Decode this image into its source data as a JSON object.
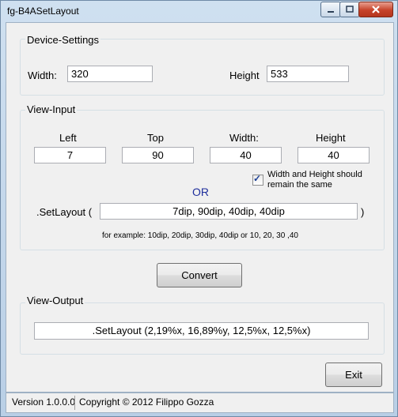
{
  "window": {
    "title": "fg-B4ASetLayout",
    "min_icon": "minimize-icon",
    "max_icon": "maximize-icon",
    "close_icon": "close-icon"
  },
  "device_settings": {
    "group_label": "Device-Settings",
    "width_label": "Width:",
    "width_value": "320",
    "height_label": "Height",
    "height_value": "533"
  },
  "view_input": {
    "group_label": "View-Input",
    "left_label": "Left",
    "left_value": "7",
    "top_label": "Top",
    "top_value": "90",
    "width_label": "Width:",
    "width_value": "40",
    "height_label": "Height",
    "height_value": "40",
    "checkbox_label_line1": "Width and Height should",
    "checkbox_label_line2": "remain the same",
    "checkbox_checked": true,
    "or_label": "OR",
    "or_color": "#1f2f9c",
    "setlayout_label": ".SetLayout (",
    "setlayout_value": "7dip, 90dip, 40dip, 40dip",
    "setlayout_close": ")",
    "example_text": "for example: 10dip, 20dip, 30dip, 40dip  or  10, 20, 30 ,40"
  },
  "convert_button": "Convert",
  "view_output": {
    "group_label": "View-Output",
    "output_value": ".SetLayout (2,19%x, 16,89%y, 12,5%x, 12,5%x)"
  },
  "exit_button": "Exit",
  "status": {
    "version": "Version 1.0.0.0",
    "copyright": "Copyright © 2012 Filippo Gozza"
  }
}
